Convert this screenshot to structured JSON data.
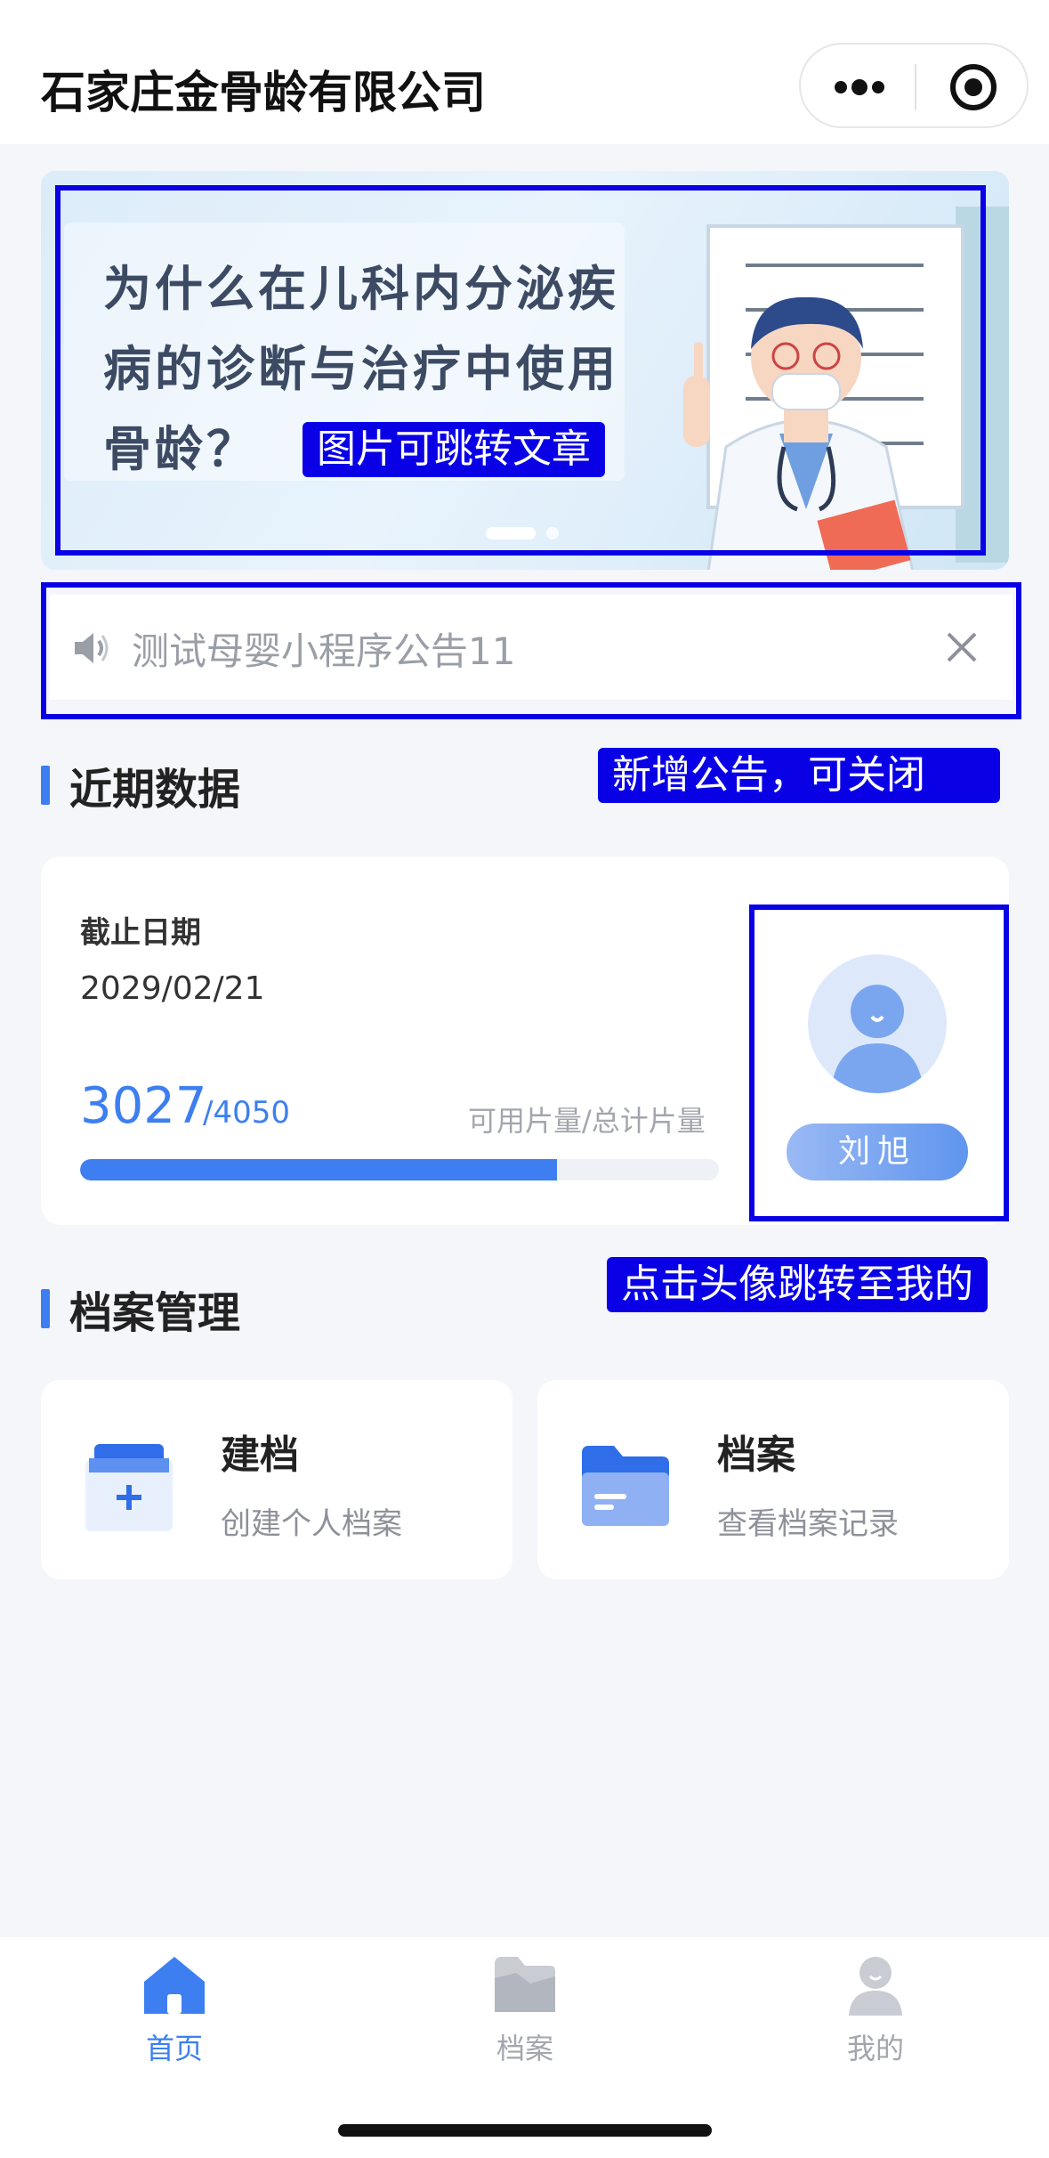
{
  "header": {
    "title": "石家庄金骨龄有限公司"
  },
  "banner": {
    "text_lines": [
      "为什么在儿科内分泌疾",
      "病的诊断与治疗中使用",
      "骨龄？"
    ]
  },
  "annotations": {
    "banner": "图片可跳转文章",
    "notice": "新增公告，可关闭",
    "avatar": "点击头像跳转至我的"
  },
  "notice": {
    "text": "测试母婴小程序公告11"
  },
  "recent": {
    "section_title": "近期数据",
    "deadline_label": "截止日期",
    "deadline_date": "2029/02/21",
    "available": "3027",
    "total": "/4050",
    "caption": "可用片量/总计片量",
    "progress_fraction": 0.747,
    "user_name": "刘旭"
  },
  "archive": {
    "section_title": "档案管理",
    "cards": [
      {
        "title": "建档",
        "subtitle": "创建个人档案"
      },
      {
        "title": "档案",
        "subtitle": "查看档案记录"
      }
    ]
  },
  "tabbar": {
    "items": [
      {
        "label": "首页",
        "active": true
      },
      {
        "label": "档案",
        "active": false
      },
      {
        "label": "我的",
        "active": false
      }
    ]
  },
  "colors": {
    "accent": "#3d7ff0",
    "annotation": "#0a00e6",
    "inactive": "#a3a6ad"
  }
}
